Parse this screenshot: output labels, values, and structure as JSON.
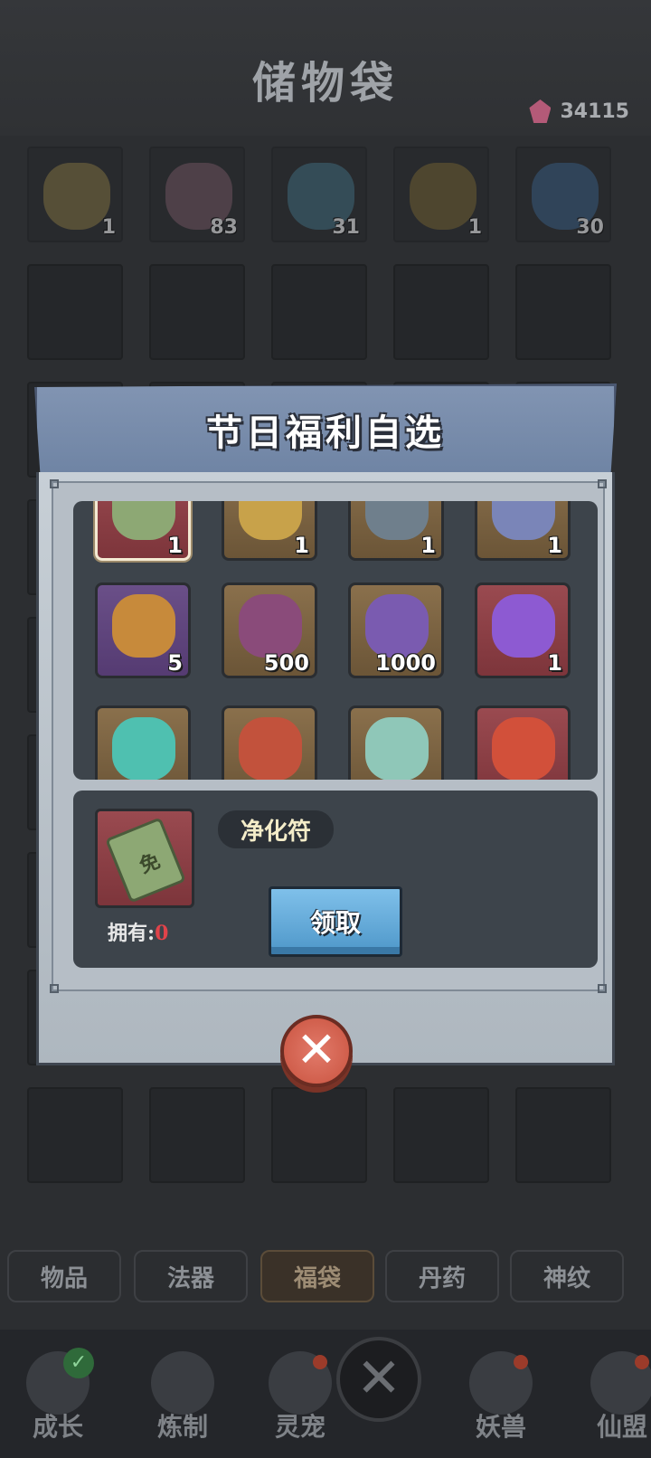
{
  "page": {
    "title": "储物袋",
    "currency_value": "34115"
  },
  "bags": [
    {
      "count": "1",
      "color": "#7a6a3d"
    },
    {
      "count": "83",
      "color": "#6b4f5c"
    },
    {
      "count": "31",
      "color": "#3c6677"
    },
    {
      "count": "1",
      "color": "#6b5b2f"
    },
    {
      "count": "30",
      "color": "#35577b"
    }
  ],
  "dialog": {
    "title": "节日福利自选",
    "rewards": [
      {
        "count": "1",
        "frame": "red",
        "icon": "purify-talisman-icon",
        "art": "#8da874"
      },
      {
        "count": "1",
        "frame": "gold",
        "icon": "yin-yang-mirror-icon",
        "art": "#c8a24a"
      },
      {
        "count": "1",
        "frame": "gold",
        "icon": "spear-icon",
        "art": "#6f7f8c"
      },
      {
        "count": "1",
        "frame": "gold",
        "icon": "armor-icon",
        "art": "#7a85b8"
      },
      {
        "count": "5",
        "frame": "purple",
        "icon": "loot-bag-icon",
        "art": "#c78a3b"
      },
      {
        "count": "500",
        "frame": "gold",
        "icon": "spirit-bag-icon",
        "art": "#8a4b7a"
      },
      {
        "count": "1000",
        "frame": "gold",
        "icon": "spirit-pill-icon",
        "art": "#7a5bb0"
      },
      {
        "count": "1",
        "frame": "red",
        "icon": "purple-token-icon",
        "art": "#8d5ad2"
      },
      {
        "count": "",
        "frame": "gold",
        "icon": "jade-crystal-icon",
        "art": "#4fc0b0"
      },
      {
        "count": "",
        "frame": "gold",
        "icon": "dragon-portrait-icon",
        "art": "#c2523c"
      },
      {
        "count": "",
        "frame": "gold",
        "icon": "fairy-portrait-icon",
        "art": "#8fc7b8"
      },
      {
        "count": "",
        "frame": "red",
        "icon": "phoenix-portrait-icon",
        "art": "#d2503a"
      }
    ],
    "selected": {
      "name": "净化符",
      "owned_label": "拥有:",
      "owned_value": "0",
      "icon_char": "免"
    },
    "claim_label": "领取",
    "close_symbol": "✕"
  },
  "tabs": [
    "物品",
    "法器",
    "福袋",
    "丹药",
    "神纹"
  ],
  "active_tab": "福袋",
  "nav": [
    {
      "label": "成长",
      "badge": "check"
    },
    {
      "label": "炼制",
      "badge": ""
    },
    {
      "label": "灵宠",
      "badge": "dot"
    },
    {
      "label": "妖兽",
      "badge": "dot"
    },
    {
      "label": "仙盟",
      "badge": "dot"
    }
  ],
  "nav_center_symbol": "✕"
}
